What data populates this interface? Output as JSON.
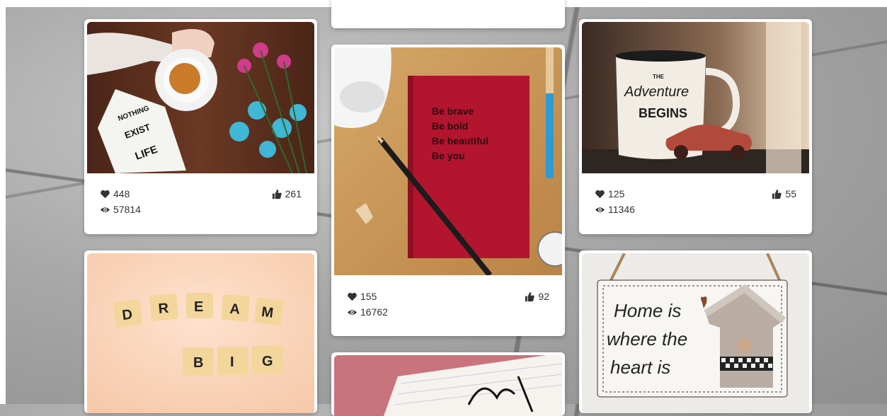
{
  "cards": [
    {
      "photo_icon": "teacup-book-flowers-photo",
      "book_text": [
        "NOTHING",
        "EXIST",
        "LIFE"
      ],
      "likes": "448",
      "views": "57814",
      "thumbs": "261"
    },
    {
      "photo_icon": "red-notebook-photo",
      "notebook_text": [
        "Be brave",
        "Be bold",
        "Be beautiful",
        "Be you"
      ],
      "likes": "155",
      "views": "16762",
      "thumbs": "92"
    },
    {
      "photo_icon": "adventure-mug-photo",
      "mug_text": [
        "THE",
        "Adventure",
        "BEGINS"
      ],
      "likes": "125",
      "views": "11346",
      "thumbs": "55"
    },
    {
      "photo_icon": "scrabble-tiles-photo",
      "tiles_row1": [
        "D",
        "R",
        "E",
        "A",
        "M"
      ],
      "tiles_row2": [
        "B",
        "I",
        "G"
      ]
    },
    {
      "photo_icon": "handwritten-notebook-photo"
    },
    {
      "photo_icon": "home-sign-photo",
      "sign_text": [
        "Home is",
        "where the",
        "heart is"
      ]
    }
  ],
  "icons": {
    "likes": "heart-icon",
    "views": "eye-icon",
    "thumbs": "thumbs-up-icon"
  },
  "colors": {
    "card_bg": "#ffffff",
    "text": "#333333",
    "notebook_red": "#b3152e"
  }
}
